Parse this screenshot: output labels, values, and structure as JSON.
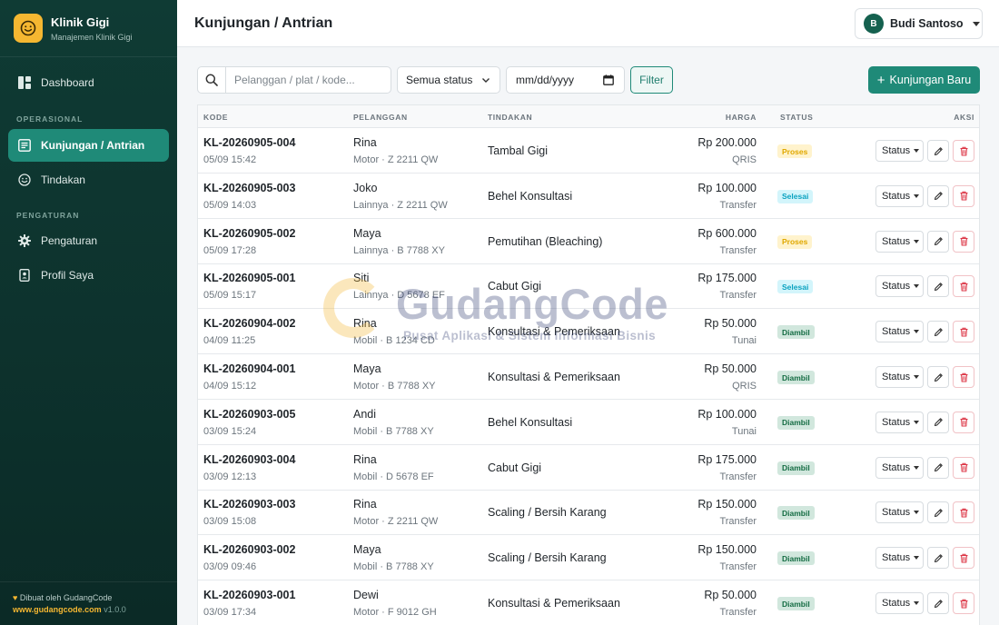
{
  "app": {
    "name": "Klinik Gigi",
    "subtitle": "Manajemen Klinik Gigi",
    "footer_made": "Dibuat oleh GudangCode",
    "footer_site": "www.gudangcode.com",
    "footer_version": "v1.0.0"
  },
  "sidebar": {
    "dashboard": "Dashboard",
    "section_operasional": "OPERASIONAL",
    "kunjungan": "Kunjungan / Antrian",
    "tindakan": "Tindakan",
    "section_pengaturan": "PENGATURAN",
    "pengaturan": "Pengaturan",
    "profil": "Profil Saya"
  },
  "header": {
    "title": "Kunjungan / Antrian",
    "user_initial": "B",
    "user_name": "Budi Santoso"
  },
  "toolbar": {
    "search_placeholder": "Pelanggan / plat / kode...",
    "status_select": "Semua status",
    "date_placeholder": "mm/dd/yyyy",
    "filter_label": "Filter",
    "new_label": "Kunjungan Baru"
  },
  "table": {
    "headers": {
      "kode": "KODE",
      "pelanggan": "PELANGGAN",
      "tindakan": "TINDAKAN",
      "harga": "HARGA",
      "status": "STATUS",
      "aksi": "AKSI"
    },
    "status_button": "Status",
    "rows": [
      {
        "code": "KL-20260905-004",
        "time": "05/09 15:42",
        "name": "Rina",
        "vehicle": "Motor · Z 2211 QW",
        "treatment": "Tambal Gigi",
        "price": "Rp 200.000",
        "payment": "QRIS",
        "status": "Proses",
        "status_type": "proses"
      },
      {
        "code": "KL-20260905-003",
        "time": "05/09 14:03",
        "name": "Joko",
        "vehicle": "Lainnya · Z 2211 QW",
        "treatment": "Behel Konsultasi",
        "price": "Rp 100.000",
        "payment": "Transfer",
        "status": "Selesai",
        "status_type": "selesai"
      },
      {
        "code": "KL-20260905-002",
        "time": "05/09 17:28",
        "name": "Maya",
        "vehicle": "Lainnya · B 7788 XY",
        "treatment": "Pemutihan (Bleaching)",
        "price": "Rp 600.000",
        "payment": "Transfer",
        "status": "Proses",
        "status_type": "proses"
      },
      {
        "code": "KL-20260905-001",
        "time": "05/09 15:17",
        "name": "Siti",
        "vehicle": "Lainnya · D 5678 EF",
        "treatment": "Cabut Gigi",
        "price": "Rp 175.000",
        "payment": "Transfer",
        "status": "Selesai",
        "status_type": "selesai"
      },
      {
        "code": "KL-20260904-002",
        "time": "04/09 11:25",
        "name": "Rina",
        "vehicle": "Mobil · B 1234 CD",
        "treatment": "Konsultasi & Pemeriksaan",
        "price": "Rp 50.000",
        "payment": "Tunai",
        "status": "Diambil",
        "status_type": "diambil"
      },
      {
        "code": "KL-20260904-001",
        "time": "04/09 15:12",
        "name": "Maya",
        "vehicle": "Motor · B 7788 XY",
        "treatment": "Konsultasi & Pemeriksaan",
        "price": "Rp 50.000",
        "payment": "QRIS",
        "status": "Diambil",
        "status_type": "diambil"
      },
      {
        "code": "KL-20260903-005",
        "time": "03/09 15:24",
        "name": "Andi",
        "vehicle": "Mobil · B 7788 XY",
        "treatment": "Behel Konsultasi",
        "price": "Rp 100.000",
        "payment": "Tunai",
        "status": "Diambil",
        "status_type": "diambil"
      },
      {
        "code": "KL-20260903-004",
        "time": "03/09 12:13",
        "name": "Rina",
        "vehicle": "Mobil · D 5678 EF",
        "treatment": "Cabut Gigi",
        "price": "Rp 175.000",
        "payment": "Transfer",
        "status": "Diambil",
        "status_type": "diambil"
      },
      {
        "code": "KL-20260903-003",
        "time": "03/09 15:08",
        "name": "Rina",
        "vehicle": "Motor · Z 2211 QW",
        "treatment": "Scaling / Bersih Karang",
        "price": "Rp 150.000",
        "payment": "Transfer",
        "status": "Diambil",
        "status_type": "diambil"
      },
      {
        "code": "KL-20260903-002",
        "time": "03/09 09:46",
        "name": "Maya",
        "vehicle": "Mobil · B 7788 XY",
        "treatment": "Scaling / Bersih Karang",
        "price": "Rp 150.000",
        "payment": "Transfer",
        "status": "Diambil",
        "status_type": "diambil"
      },
      {
        "code": "KL-20260903-001",
        "time": "03/09 17:34",
        "name": "Dewi",
        "vehicle": "Motor · F 9012 GH",
        "treatment": "Konsultasi & Pemeriksaan",
        "price": "Rp 50.000",
        "payment": "Transfer",
        "status": "Diambil",
        "status_type": "diambil"
      }
    ]
  },
  "watermark": {
    "title": "GudangCode",
    "subtitle": "Pusat Aplikasi & Sistem Informasi Bisnis"
  },
  "colors": {
    "sidebar_bg": "#0f3b34",
    "accent": "#1f8a78",
    "brand_yellow": "#f5b731",
    "status_proses": "#e0a800",
    "status_selesai": "#0aa2c0",
    "status_diambil": "#146c43",
    "danger": "#dc3545"
  },
  "icons": {
    "brand": "smile-icon",
    "dashboard": "dashboard-icon",
    "kunjungan": "list-icon",
    "tindakan": "smile-icon",
    "pengaturan": "gear-icon",
    "profil": "id-badge-icon",
    "search": "search-icon",
    "calendar": "calendar-icon",
    "edit": "pencil-icon",
    "delete": "trash-icon",
    "footer": "heart-icon"
  }
}
